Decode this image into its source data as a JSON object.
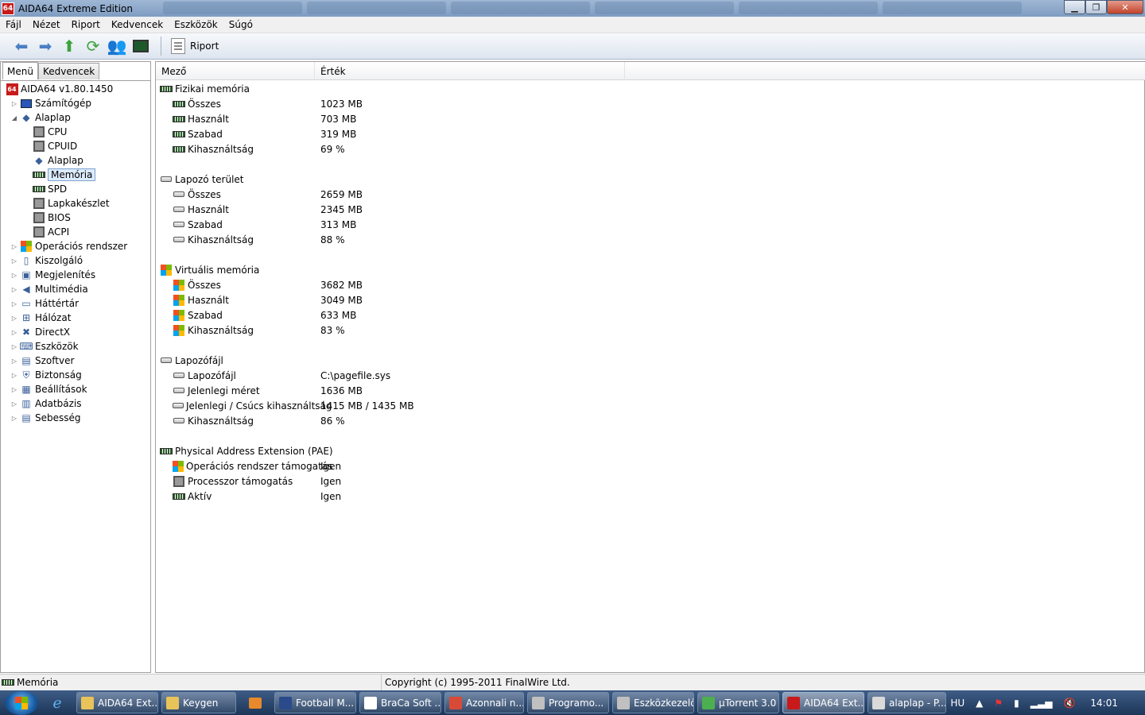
{
  "window": {
    "title": "AIDA64 Extreme Edition",
    "logo": "64"
  },
  "menubar": [
    "Fájl",
    "Nézet",
    "Riport",
    "Kedvencek",
    "Eszközök",
    "Súgó"
  ],
  "toolbar": {
    "report_label": "Riport",
    "icons": [
      "back-arrow-icon",
      "forward-arrow-icon",
      "up-arrow-icon",
      "refresh-icon",
      "user-icon",
      "monitor-icon"
    ]
  },
  "left": {
    "tabs": [
      "Menü",
      "Kedvencek"
    ],
    "tree": [
      {
        "label": "AIDA64 v1.80.1450",
        "level": 0,
        "icon": "aida-logo-icon"
      },
      {
        "label": "Számítógép",
        "level": 1,
        "icon": "computer-icon",
        "expander": "▷"
      },
      {
        "label": "Alaplap",
        "level": 1,
        "icon": "motherboard-icon",
        "expander": "◢"
      },
      {
        "label": "CPU",
        "level": 2,
        "icon": "chip-icon"
      },
      {
        "label": "CPUID",
        "level": 2,
        "icon": "chip-icon"
      },
      {
        "label": "Alaplap",
        "level": 2,
        "icon": "motherboard-icon"
      },
      {
        "label": "Memória",
        "level": 2,
        "icon": "ram-icon",
        "selected": true
      },
      {
        "label": "SPD",
        "level": 2,
        "icon": "ram-icon"
      },
      {
        "label": "Lapkakészlet",
        "level": 2,
        "icon": "chip-icon"
      },
      {
        "label": "BIOS",
        "level": 2,
        "icon": "chip-icon"
      },
      {
        "label": "ACPI",
        "level": 2,
        "icon": "chip-icon"
      },
      {
        "label": "Operációs rendszer",
        "level": 1,
        "icon": "windows-icon",
        "expander": "▷"
      },
      {
        "label": "Kiszolgáló",
        "level": 1,
        "icon": "server-icon",
        "expander": "▷"
      },
      {
        "label": "Megjelenítés",
        "level": 1,
        "icon": "display-icon",
        "expander": "▷"
      },
      {
        "label": "Multimédia",
        "level": 1,
        "icon": "speaker-icon",
        "expander": "▷"
      },
      {
        "label": "Háttértár",
        "level": 1,
        "icon": "storage-icon",
        "expander": "▷"
      },
      {
        "label": "Hálózat",
        "level": 1,
        "icon": "network-icon",
        "expander": "▷"
      },
      {
        "label": "DirectX",
        "level": 1,
        "icon": "directx-icon",
        "expander": "▷"
      },
      {
        "label": "Eszközök",
        "level": 1,
        "icon": "devices-icon",
        "expander": "▷"
      },
      {
        "label": "Szoftver",
        "level": 1,
        "icon": "software-icon",
        "expander": "▷"
      },
      {
        "label": "Biztonság",
        "level": 1,
        "icon": "shield-icon",
        "expander": "▷"
      },
      {
        "label": "Beállítások",
        "level": 1,
        "icon": "settings-icon",
        "expander": "▷"
      },
      {
        "label": "Adatbázis",
        "level": 1,
        "icon": "database-icon",
        "expander": "▷"
      },
      {
        "label": "Sebesség",
        "level": 1,
        "icon": "benchmark-icon",
        "expander": "▷"
      }
    ]
  },
  "right": {
    "columns": [
      "Mező",
      "Érték"
    ],
    "rows": [
      {
        "kind": "group",
        "field": "Fizikai memória",
        "icon": "ram-icon"
      },
      {
        "kind": "item",
        "field": "Összes",
        "value": "1023 MB",
        "icon": "ram-icon"
      },
      {
        "kind": "item",
        "field": "Használt",
        "value": "703 MB",
        "icon": "ram-icon"
      },
      {
        "kind": "item",
        "field": "Szabad",
        "value": "319 MB",
        "icon": "ram-icon"
      },
      {
        "kind": "item",
        "field": "Kihasználtság",
        "value": "69 %",
        "icon": "ram-icon"
      },
      {
        "kind": "spacer"
      },
      {
        "kind": "group",
        "field": "Lapozó terület",
        "icon": "disk-icon"
      },
      {
        "kind": "item",
        "field": "Összes",
        "value": "2659 MB",
        "icon": "disk-icon"
      },
      {
        "kind": "item",
        "field": "Használt",
        "value": "2345 MB",
        "icon": "disk-icon"
      },
      {
        "kind": "item",
        "field": "Szabad",
        "value": "313 MB",
        "icon": "disk-icon"
      },
      {
        "kind": "item",
        "field": "Kihasználtság",
        "value": "88 %",
        "icon": "disk-icon"
      },
      {
        "kind": "spacer"
      },
      {
        "kind": "group",
        "field": "Virtuális memória",
        "icon": "windows-icon"
      },
      {
        "kind": "item",
        "field": "Összes",
        "value": "3682 MB",
        "icon": "windows-icon"
      },
      {
        "kind": "item",
        "field": "Használt",
        "value": "3049 MB",
        "icon": "windows-icon"
      },
      {
        "kind": "item",
        "field": "Szabad",
        "value": "633 MB",
        "icon": "windows-icon"
      },
      {
        "kind": "item",
        "field": "Kihasználtság",
        "value": "83 %",
        "icon": "windows-icon"
      },
      {
        "kind": "spacer"
      },
      {
        "kind": "group",
        "field": "Lapozófájl",
        "icon": "disk-icon"
      },
      {
        "kind": "item",
        "field": "Lapozófájl",
        "value": "C:\\pagefile.sys",
        "icon": "disk-icon"
      },
      {
        "kind": "item",
        "field": "Jelenlegi méret",
        "value": "1636 MB",
        "icon": "disk-icon"
      },
      {
        "kind": "item",
        "field": "Jelenlegi / Csúcs kihasználtság",
        "value": "1415 MB / 1435 MB",
        "icon": "disk-icon"
      },
      {
        "kind": "item",
        "field": "Kihasználtság",
        "value": "86 %",
        "icon": "disk-icon"
      },
      {
        "kind": "spacer"
      },
      {
        "kind": "group",
        "field": "Physical Address Extension (PAE)",
        "icon": "ram-icon"
      },
      {
        "kind": "item",
        "field": "Operációs rendszer támogatás",
        "value": "Igen",
        "icon": "windows-icon"
      },
      {
        "kind": "item",
        "field": "Processzor támogatás",
        "value": "Igen",
        "icon": "chip-icon"
      },
      {
        "kind": "item",
        "field": "Aktív",
        "value": "Igen",
        "icon": "ram-icon"
      }
    ]
  },
  "statusbar": {
    "left": "Memória",
    "right": "Copyright (c) 1995-2011 FinalWire Ltd."
  },
  "taskbar": {
    "tasks": [
      {
        "kind": "task",
        "label": "AIDA64 Ext...",
        "icon": "folder-icon",
        "color": "#e8c35a"
      },
      {
        "kind": "task",
        "label": "Keygen",
        "icon": "folder-icon",
        "color": "#e8c35a"
      },
      {
        "kind": "pin",
        "icon": "media-player-icon"
      },
      {
        "kind": "task",
        "label": "Football M...",
        "icon": "football-manager-icon",
        "color": "#2b4a8c"
      },
      {
        "kind": "task",
        "label": "BraCa Soft ...",
        "icon": "soccer-ball-icon",
        "color": "#ffffff"
      },
      {
        "kind": "task",
        "label": "Azonnali n...",
        "icon": "chrome-icon",
        "color": "#d84a38"
      },
      {
        "kind": "task",
        "label": "Programo...",
        "icon": "program-icon",
        "color": "#c0c0c0"
      },
      {
        "kind": "task",
        "label": "Eszközkezelő",
        "icon": "device-manager-icon",
        "color": "#c0c0c0"
      },
      {
        "kind": "task",
        "label": "µTorrent 3.0",
        "icon": "utorrent-icon",
        "color": "#4caf50"
      },
      {
        "kind": "task",
        "label": "AIDA64 Ext...",
        "icon": "aida-logo-icon",
        "color": "#c81a1a",
        "active": true
      },
      {
        "kind": "task",
        "label": "alaplap - P...",
        "icon": "paint-icon",
        "color": "#d9d9d9"
      }
    ],
    "tray": {
      "language": "HU",
      "time": "14:01"
    }
  },
  "colors": {
    "accent": "#c81a1a",
    "selection": "#dcebfc",
    "taskbar": "#2b4a73"
  }
}
